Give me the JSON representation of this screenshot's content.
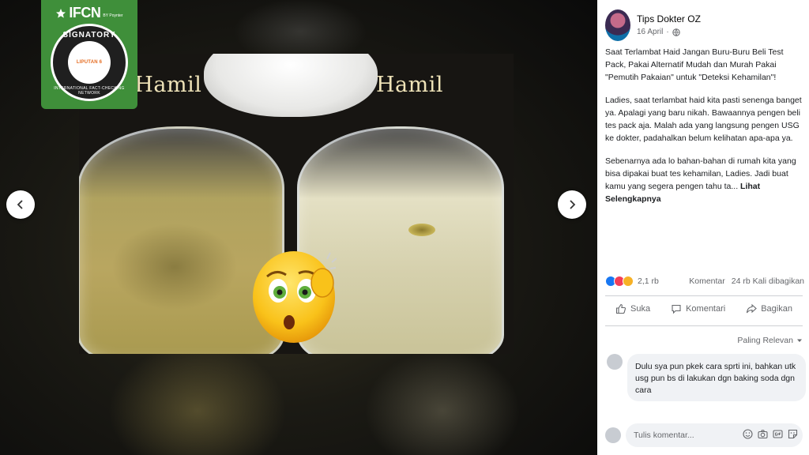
{
  "viewer": {
    "photo": {
      "caption_left": "dak Hamil",
      "caption_right": "Hamil"
    },
    "badge": {
      "title": "IFCN",
      "subtitle": "BY Poynter",
      "signatory": "SIGNATORY",
      "network": "INTERNATIONAL FACT-CHECKING NETWORK",
      "logo_text": "LIPUTAN 6"
    },
    "nav": {
      "prev_icon": "chevron-left-icon",
      "next_icon": "chevron-right-icon"
    }
  },
  "post": {
    "author": "Tips Dokter OZ",
    "date": "16 April",
    "privacy_icon": "globe-icon",
    "text_paragraphs": [
      "Saat Terlambat Haid Jangan Buru-Buru Beli Test Pack, Pakai Alternatif Mudah dan Murah Pakai \"Pemutih Pakaian\" untuk \"Deteksi Kehamilan\"!",
      "Ladies, saat terlambat haid kita pasti senenga banget ya. Apalagi yang baru nikah. Bawaannya pengen beli tes pack aja. Malah ada yang langsung pengen USG ke dokter, padahalkan belum kelihatan apa-apa ya."
    ],
    "text_last": "Sebenarnya ada lo bahan-bahan di rumah kita yang bisa dipakai buat tes kehamilan, Ladies. Jadi buat kamu yang segera pengen tahu ta...",
    "see_more": "Lihat Selengkapnya"
  },
  "reactions": {
    "count": "2,1 rb",
    "comments": "Komentar",
    "shares": "24 rb Kali dibagikan",
    "icons": [
      "like-icon",
      "love-icon",
      "wow-icon"
    ]
  },
  "actions": {
    "like": "Suka",
    "comment": "Komentari",
    "share": "Bagikan"
  },
  "comments": {
    "sort_label": "Paling Relevan",
    "items": [
      {
        "name": "",
        "text": "Dulu sya pun pkek cara sprti ini, bahkan utk usg pun bs di lakukan dgn baking soda dgn cara"
      }
    ]
  },
  "composer": {
    "placeholder": "Tulis komentar..."
  },
  "colors": {
    "badge_green": "#3f8f3a",
    "link_blue": "#1877f2",
    "muted": "#65676b"
  }
}
